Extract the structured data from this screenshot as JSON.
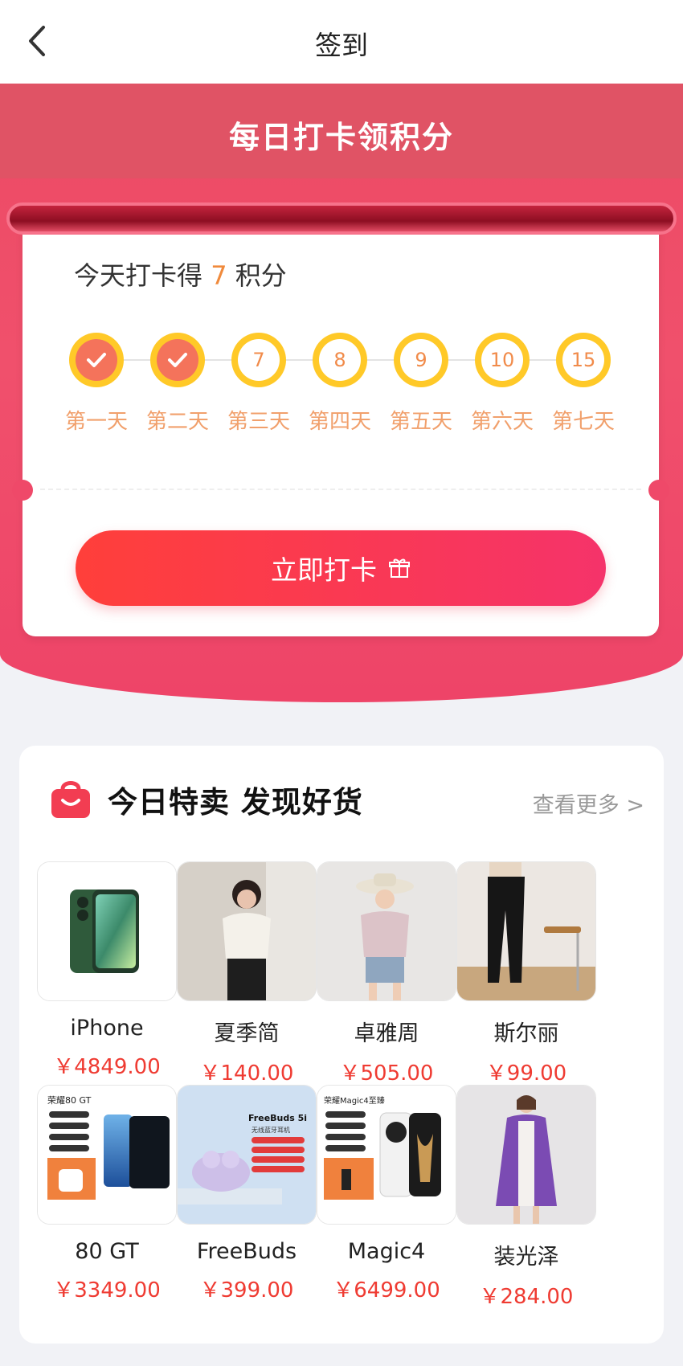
{
  "header": {
    "title": "签到"
  },
  "hero": {
    "title": "每日打卡领积分"
  },
  "card": {
    "today_prefix": "今天打卡得",
    "today_points": "7",
    "today_suffix": "积分",
    "days": [
      {
        "label": "第一天",
        "value": "",
        "done": true
      },
      {
        "label": "第二天",
        "value": "",
        "done": true
      },
      {
        "label": "第三天",
        "value": "7",
        "done": false
      },
      {
        "label": "第四天",
        "value": "8",
        "done": false
      },
      {
        "label": "第五天",
        "value": "9",
        "done": false
      },
      {
        "label": "第六天",
        "value": "10",
        "done": false
      },
      {
        "label": "第七天",
        "value": "15",
        "done": false
      }
    ],
    "checkin_label": "立即打卡"
  },
  "sale": {
    "title": "今日特卖 发现好货",
    "more": "查看更多 >",
    "items": [
      {
        "name": "iPhone",
        "price": "￥4849.00",
        "img": "phone-green"
      },
      {
        "name": "夏季简",
        "price": "￥140.00",
        "img": "woman-blouse"
      },
      {
        "name": "卓雅周",
        "price": "￥505.00",
        "img": "woman-hat"
      },
      {
        "name": "斯尔丽",
        "price": "￥99.00",
        "img": "black-pants"
      },
      {
        "name": "80 GT",
        "price": "￥3349.00",
        "img": "phone-blue-ad"
      },
      {
        "name": "FreeBuds",
        "price": "￥399.00",
        "img": "earbuds-ad"
      },
      {
        "name": "Magic4",
        "price": "￥6499.00",
        "img": "phone-white-ad"
      },
      {
        "name": "装光泽",
        "price": "￥284.00",
        "img": "purple-coat"
      }
    ],
    "ad_texts": {
      "gt_title": "荣耀80 GT",
      "freebuds_title": "FreeBuds 5i",
      "freebuds_sub": "无线蓝牙耳机",
      "magic_title": "荣耀Magic4至臻"
    }
  }
}
